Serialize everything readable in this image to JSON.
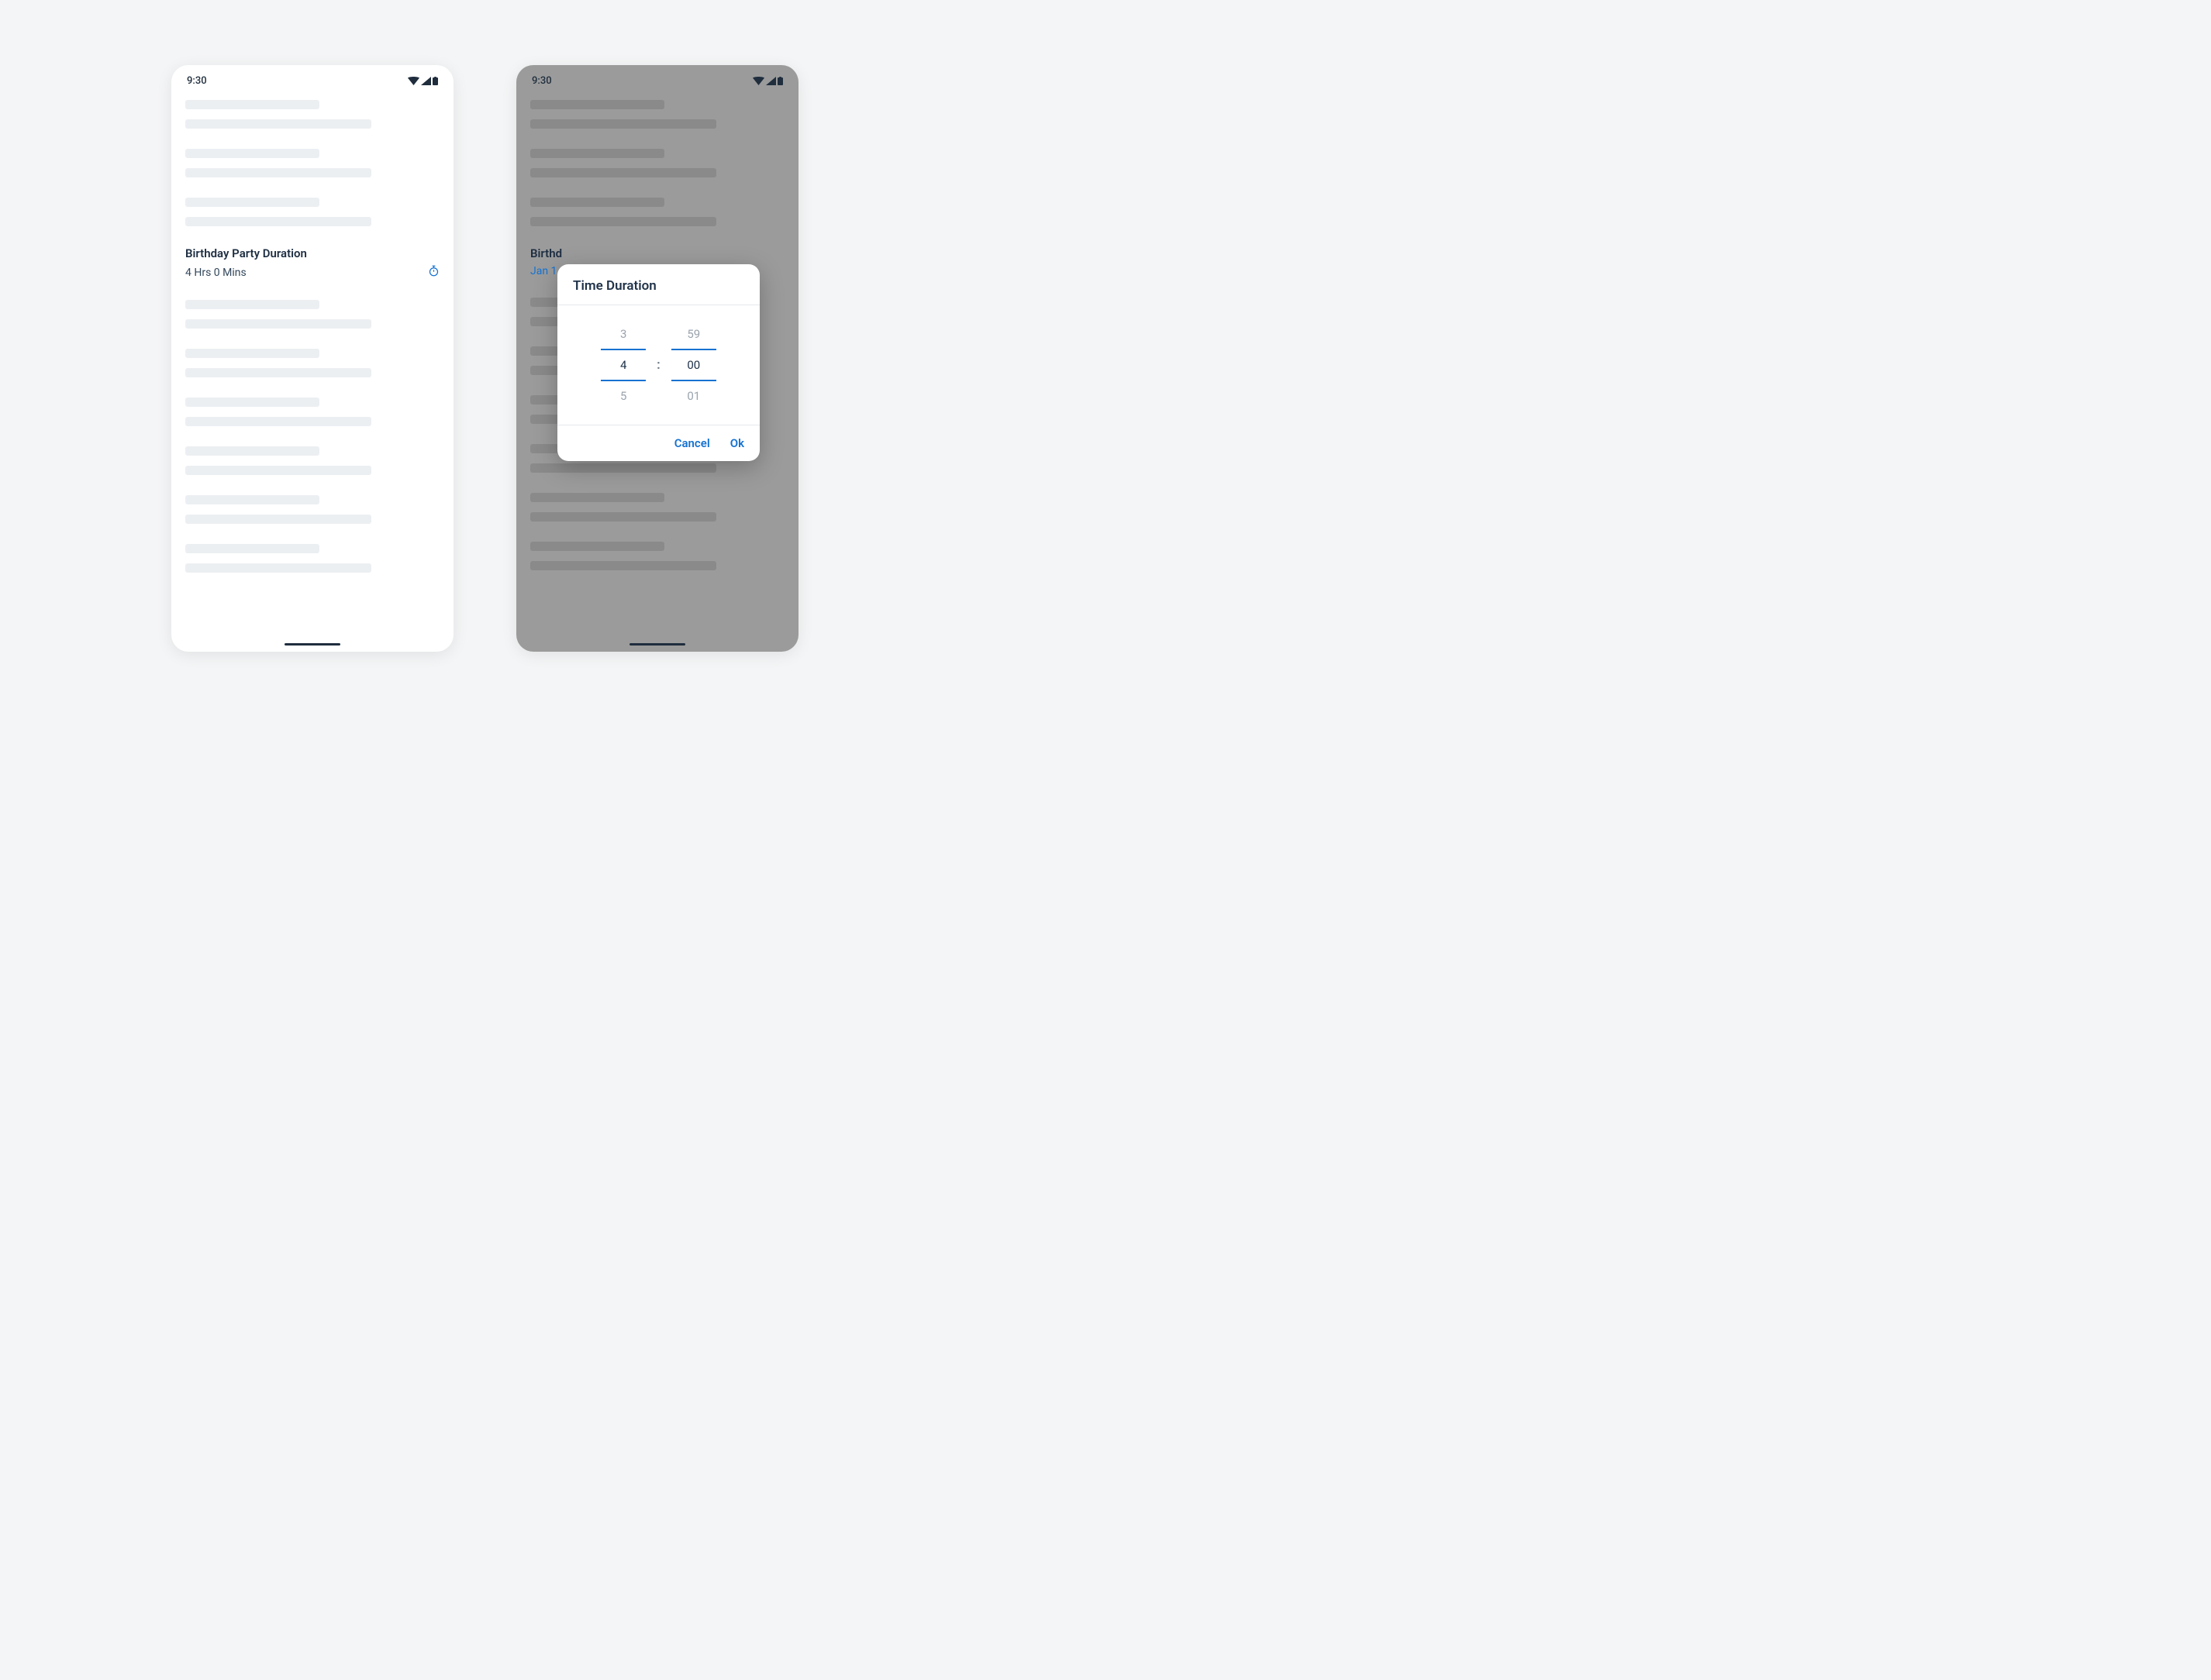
{
  "status": {
    "time": "9:30"
  },
  "field": {
    "label": "Birthday Party Duration",
    "value": "4 Hrs 0 Mins"
  },
  "field2": {
    "label_partial": "Birthd",
    "value_partial": "Jan 1"
  },
  "dialog": {
    "title": "Time Duration",
    "hours": {
      "prev": "3",
      "current": "4",
      "next": "5"
    },
    "minutes": {
      "prev": "59",
      "current": "00",
      "next": "01"
    },
    "separator": ":",
    "cancel": "Cancel",
    "ok": "Ok"
  }
}
